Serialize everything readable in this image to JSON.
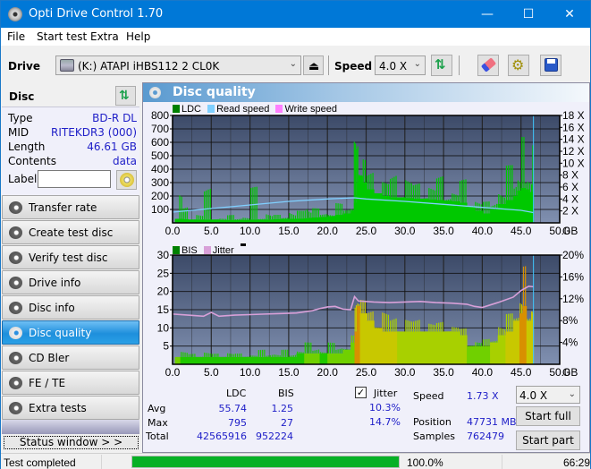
{
  "window": {
    "title": "Opti Drive Control 1.70",
    "minimize": "—",
    "maximize": "☐",
    "close": "✕"
  },
  "menu": [
    "File",
    "Start test",
    "Extra",
    "Help"
  ],
  "toolbar": {
    "drive_label": "Drive",
    "drive_value": "(K:)  ATAPI iHBS112  2 CL0K",
    "speed_label": "Speed",
    "speed_value": "4.0 X",
    "icons": [
      "drive-icon",
      "eject-icon",
      "refresh-icon",
      "erase-icon",
      "settings-icon",
      "save-icon"
    ]
  },
  "disc": {
    "header": "Disc",
    "rows": [
      {
        "key": "Type",
        "value": "BD-R DL"
      },
      {
        "key": "MID",
        "value": "RITEKDR3 (000)"
      },
      {
        "key": "Length",
        "value": "46.61 GB"
      },
      {
        "key": "Contents",
        "value": "data"
      }
    ],
    "label_key": "Label",
    "label_value": ""
  },
  "nav": [
    {
      "label": "Transfer rate",
      "active": false
    },
    {
      "label": "Create test disc",
      "active": false
    },
    {
      "label": "Verify test disc",
      "active": false
    },
    {
      "label": "Drive info",
      "active": false
    },
    {
      "label": "Disc info",
      "active": false
    },
    {
      "label": "Disc quality",
      "active": true
    },
    {
      "label": "CD Bler",
      "active": false
    },
    {
      "label": "FE / TE",
      "active": false
    },
    {
      "label": "Extra tests",
      "active": false
    }
  ],
  "status_window_btn": "Status window > >",
  "panel": {
    "title": "Disc quality"
  },
  "colors": {
    "ldc": "#00c800",
    "read_speed": "#80d0ff",
    "write_speed": "#ff80ff",
    "bis": "#00c800",
    "jitter": "#d8a0d8",
    "plot_bg_top": "#3c4a68",
    "plot_bg_bottom": "#8090b0",
    "accent": "#0078d7",
    "progress": "#06b025"
  },
  "chart_data": [
    {
      "type": "bar",
      "title": "",
      "legend": [
        "LDC",
        "Read speed",
        "Write speed"
      ],
      "legend_position": "top-left",
      "xlabel": "GB",
      "x_ticks": [
        "0.0",
        "5.0",
        "10.0",
        "15.0",
        "20.0",
        "25.0",
        "30.0",
        "35.0",
        "40.0",
        "45.0",
        "50.0"
      ],
      "xlim": [
        0,
        50
      ],
      "y_ticks_left": [
        "100",
        "200",
        "300",
        "400",
        "500",
        "600",
        "700",
        "800"
      ],
      "ylim_left": [
        0,
        800
      ],
      "y_ticks_right": [
        "2 X",
        "4 X",
        "6 X",
        "8 X",
        "10 X",
        "12 X",
        "14 X",
        "16 X",
        "18 X"
      ],
      "ylim_right": [
        0,
        18
      ],
      "grid": true,
      "series": [
        {
          "name": "LDC",
          "x": [
            0.3,
            0.8,
            1.3,
            2.0,
            3.0,
            4.0,
            5.0,
            6.0,
            7.0,
            8.0,
            9.0,
            10.0,
            11.0,
            12.0,
            13.0,
            14.0,
            15.0,
            16.0,
            17.0,
            17.5,
            18.0,
            19.0,
            20.0,
            21.0,
            22.0,
            23.0,
            23.4,
            23.7,
            24.0,
            24.5,
            25.0,
            26.0,
            27.0,
            28.0,
            29.0,
            30.0,
            31.0,
            32.0,
            33.0,
            34.0,
            35.0,
            36.0,
            37.0,
            38.0,
            39.0,
            40.0,
            41.0,
            42.0,
            43.0,
            44.0,
            44.5,
            45.0,
            45.5,
            46.0,
            46.5
          ],
          "base": [
            30,
            30,
            28,
            25,
            25,
            25,
            25,
            22,
            22,
            22,
            22,
            25,
            25,
            25,
            28,
            30,
            30,
            32,
            35,
            38,
            40,
            45,
            50,
            60,
            70,
            90,
            150,
            300,
            350,
            300,
            250,
            220,
            200,
            190,
            190,
            185,
            180,
            180,
            175,
            170,
            165,
            160,
            150,
            120,
            90,
            70,
            100,
            140,
            170,
            200,
            240,
            260,
            250,
            230,
            220
          ],
          "peaks": [
            120,
            280,
            130,
            60,
            80,
            270,
            60,
            40,
            60,
            90,
            60,
            270,
            50,
            140,
            60,
            60,
            200,
            90,
            270,
            300,
            110,
            90,
            130,
            150,
            120,
            280,
            640,
            795,
            700,
            500,
            420,
            380,
            330,
            390,
            380,
            370,
            310,
            330,
            310,
            360,
            350,
            270,
            330,
            180,
            240,
            160,
            330,
            350,
            430,
            560,
            530,
            640,
            460,
            600,
            580
          ]
        },
        {
          "name": "Read speed",
          "x": [
            0,
            5,
            10,
            15,
            20,
            23.5,
            25,
            30,
            35,
            40,
            45,
            46.6
          ],
          "values": [
            1.8,
            2.4,
            3.0,
            3.6,
            4.0,
            4.2,
            4.0,
            3.6,
            3.1,
            2.6,
            2.1,
            1.73
          ]
        },
        {
          "name": "Write speed",
          "x": [],
          "values": []
        }
      ],
      "end_marker_gb": 46.61
    },
    {
      "type": "bar",
      "title": "",
      "legend": [
        "BIS",
        "Jitter"
      ],
      "legend_position": "top-left",
      "xlabel": "GB",
      "x_ticks": [
        "0.0",
        "5.0",
        "10.0",
        "15.0",
        "20.0",
        "25.0",
        "30.0",
        "35.0",
        "40.0",
        "45.0",
        "50.0"
      ],
      "xlim": [
        0,
        50
      ],
      "y_ticks_left": [
        "5",
        "10",
        "15",
        "20",
        "25",
        "30"
      ],
      "ylim_left": [
        0,
        30
      ],
      "y_ticks_right": [
        "4%",
        "8%",
        "12%",
        "16%",
        "20%"
      ],
      "ylim_right": [
        0,
        20
      ],
      "grid": true,
      "series": [
        {
          "name": "BIS",
          "x": [
            0.3,
            1,
            2,
            3,
            4,
            5,
            6,
            7,
            8,
            9,
            10,
            11,
            12,
            13,
            14,
            15,
            16,
            17,
            18,
            19,
            20,
            21,
            22,
            23,
            23.5,
            23.8,
            24.2,
            25,
            26,
            27,
            28,
            29,
            30,
            31,
            32,
            33,
            34,
            35,
            36,
            37,
            38,
            39,
            40,
            41,
            42,
            43,
            44,
            44.8,
            45.2,
            45.7,
            46.3
          ],
          "base": [
            2,
            2,
            2,
            2,
            2,
            2,
            2,
            2,
            2,
            2,
            2,
            2,
            2,
            2,
            2,
            2,
            3,
            3,
            3,
            3,
            3,
            3,
            4,
            6,
            9,
            16,
            14,
            12,
            10,
            9,
            9,
            9,
            9,
            9,
            9,
            9,
            9,
            9,
            9,
            8,
            5,
            5,
            5,
            6,
            8,
            9,
            12,
            14,
            16,
            12,
            14
          ],
          "peaks": [
            6,
            4,
            3,
            4,
            4,
            3,
            3,
            4,
            3,
            3,
            3,
            4,
            5,
            4,
            4,
            4,
            5,
            6,
            6,
            5,
            6,
            6,
            6,
            8,
            25,
            27,
            18,
            16,
            16,
            15,
            14,
            13,
            13,
            13,
            12,
            12,
            12,
            12,
            11,
            10,
            7,
            7,
            7,
            10,
            13,
            14,
            17,
            22,
            27,
            15,
            16
          ]
        },
        {
          "name": "Jitter",
          "x": [
            0,
            2,
            4,
            5,
            6,
            8,
            10,
            12,
            14,
            16,
            18,
            19,
            20,
            21,
            22,
            23,
            23.5,
            24,
            26,
            28,
            30,
            32,
            34,
            36,
            38,
            39,
            40,
            42,
            44,
            45,
            46,
            46.6
          ],
          "values": [
            9.2,
            9.0,
            8.8,
            9.5,
            8.8,
            9.0,
            9.1,
            9.2,
            9.3,
            9.4,
            9.8,
            10.2,
            10.5,
            10.6,
            10.1,
            10.0,
            12.4,
            11.6,
            11.4,
            11.3,
            11.4,
            11.5,
            11.3,
            11.2,
            11.0,
            10.6,
            10.4,
            11.3,
            12.3,
            13.5,
            14.3,
            14.2
          ]
        }
      ],
      "end_marker_gb": 46.61
    }
  ],
  "stats": {
    "col_ldc": "LDC",
    "col_bis": "BIS",
    "rows": [
      {
        "label": "Avg",
        "ldc": "55.74",
        "bis": "1.25",
        "jitter": "10.3%"
      },
      {
        "label": "Max",
        "ldc": "795",
        "bis": "27",
        "jitter": "14.7%"
      },
      {
        "label": "Total",
        "ldc": "42565916",
        "bis": "952224"
      }
    ],
    "jitter_label": "Jitter",
    "jitter_checked": true,
    "speed_label": "Speed",
    "speed_value": "1.73 X",
    "position_label": "Position",
    "position_value": "47731 MB",
    "samples_label": "Samples",
    "samples_value": "762479",
    "speed_select": "4.0 X",
    "start_full": "Start full",
    "start_part": "Start part"
  },
  "statusbar": {
    "text": "Test completed",
    "progress": 1.0,
    "progress_text": "100.0%",
    "time": "66:29"
  }
}
